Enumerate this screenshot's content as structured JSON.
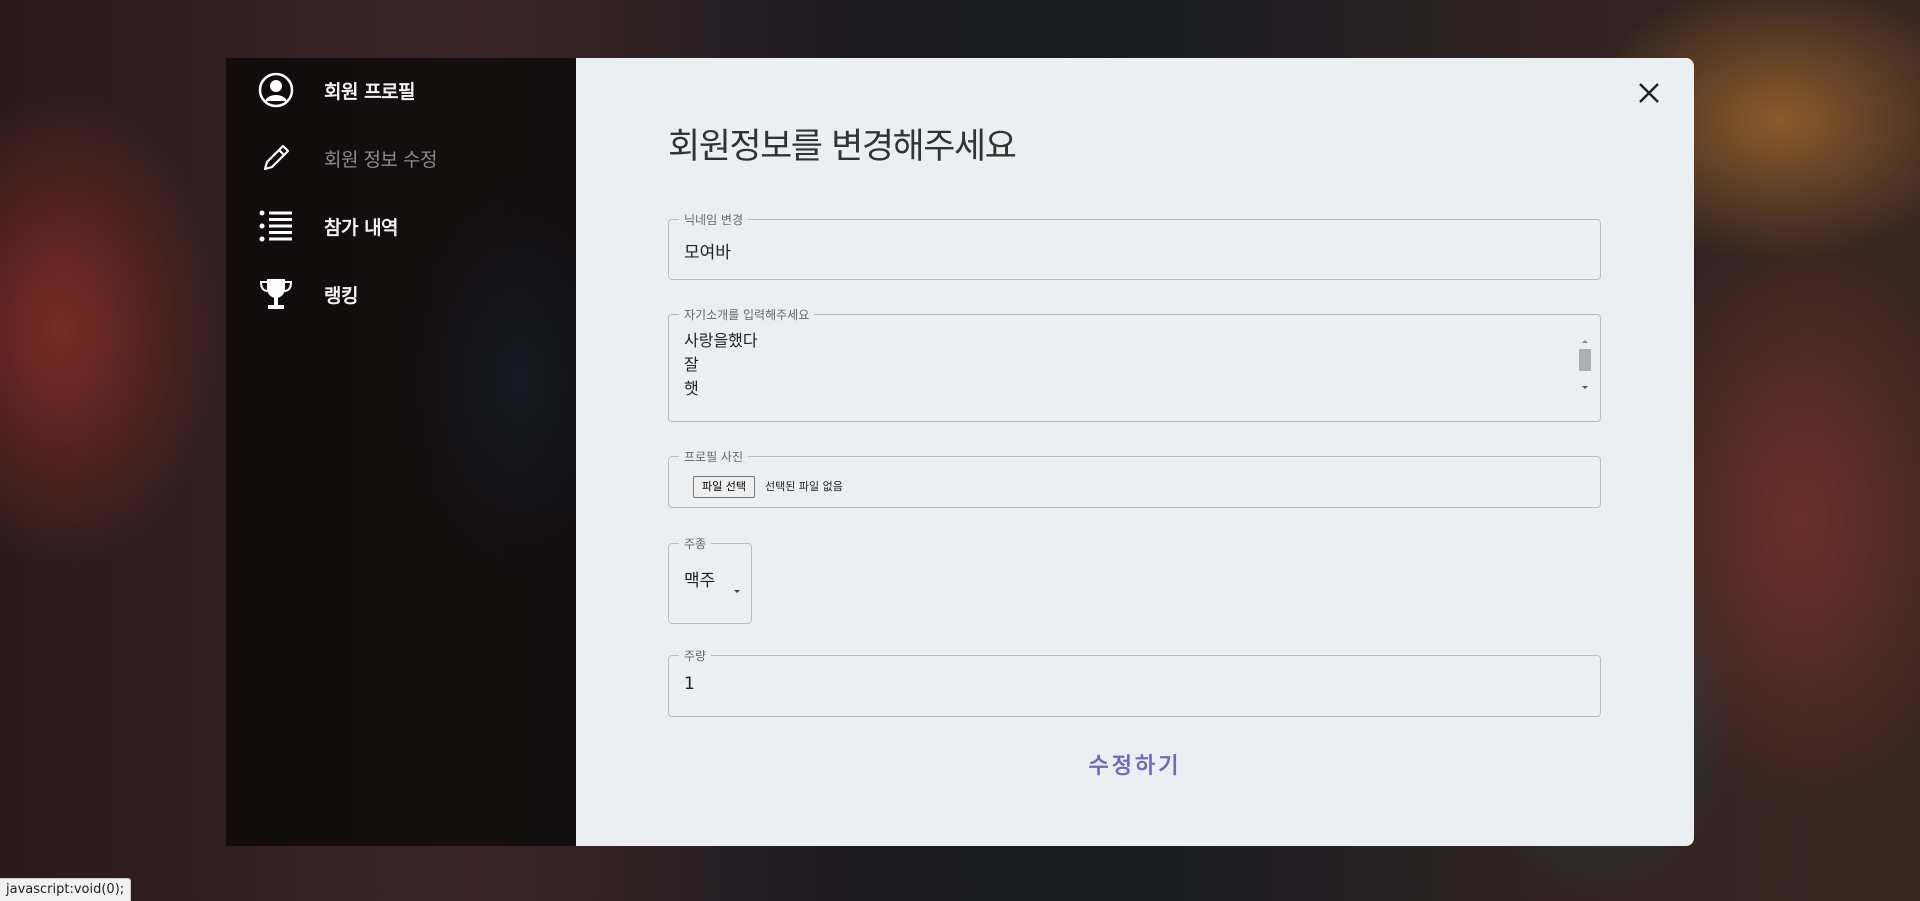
{
  "sidebar": {
    "items": [
      {
        "label": "회원 프로필",
        "icon": "user-circle-icon",
        "active": true
      },
      {
        "label": "회원 정보 수정",
        "icon": "pencil-icon",
        "active": false
      },
      {
        "label": "참가 내역",
        "icon": "list-icon",
        "active": true
      },
      {
        "label": "랭킹",
        "icon": "trophy-icon",
        "active": true
      }
    ]
  },
  "modal": {
    "title": "회원정보를 변경해주세요",
    "close_icon": "close-icon",
    "nickname": {
      "legend": "닉네임 변경",
      "value": "모여바"
    },
    "intro": {
      "legend": "자기소개를 입력해주세요",
      "lines": [
        "사랑을했다",
        "잘",
        "햇"
      ]
    },
    "photo": {
      "legend": "프로필 사진",
      "button": "파일 선택",
      "status": "선택된 파일 없음"
    },
    "drink_type": {
      "legend": "주종",
      "value": "맥주"
    },
    "drink_amount": {
      "legend": "주량",
      "value": "1"
    },
    "submit_label": "수정하기"
  },
  "status_bar": {
    "text": "javascript:void(0);"
  },
  "colors": {
    "accent": "#6d6fb6",
    "modal_bg": "#eceff2",
    "sidebar_bg": "#050505"
  }
}
